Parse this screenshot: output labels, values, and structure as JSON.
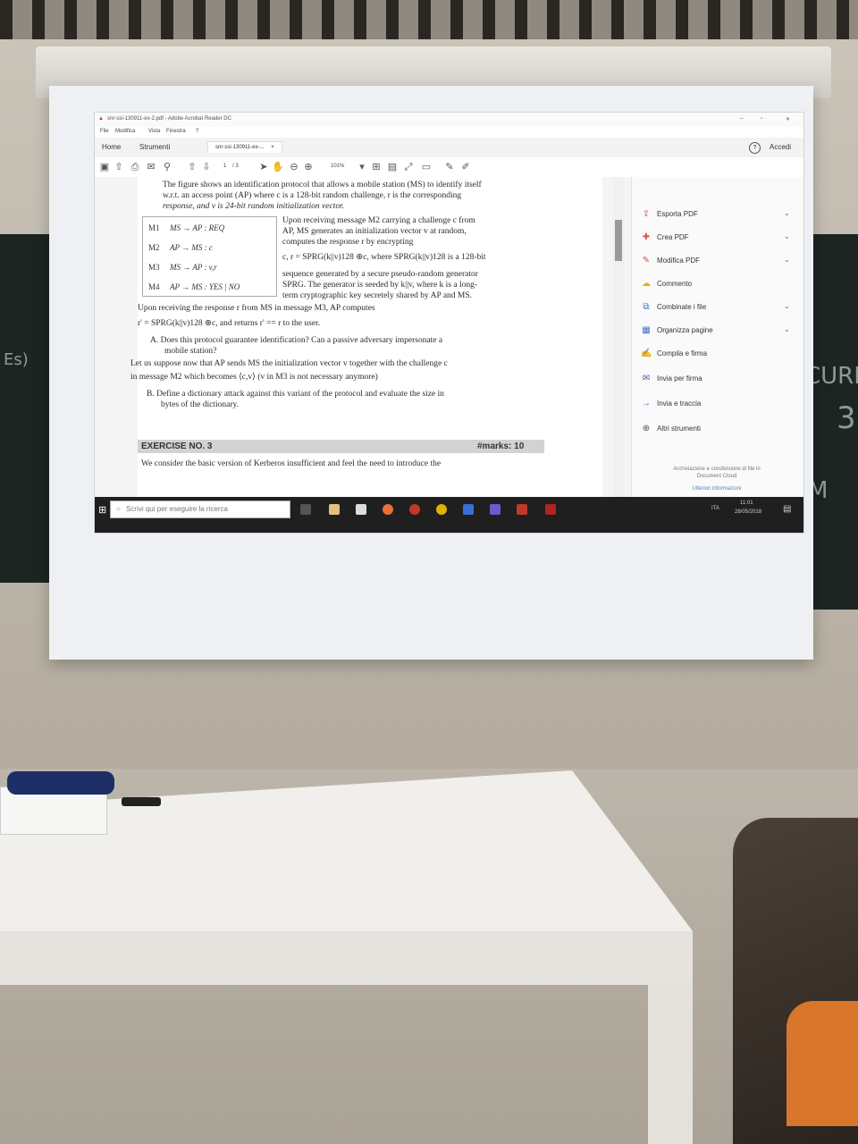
{
  "window": {
    "title": "snr-ssi-130911-ex-2.pdf - Adobe Acrobat Reader DC",
    "controls": [
      "–",
      "▫",
      "✕"
    ]
  },
  "menu": [
    "File",
    "Modifica",
    "Vista",
    "Finestra",
    "?"
  ],
  "tabs": {
    "home": "Home",
    "tools": "Strumenti",
    "document": "snr-ssi-130911-ex-...",
    "document_close": "×",
    "help": "?",
    "signin": "Accedi"
  },
  "toolbar": {
    "page_current": "1",
    "page_total": "/ 3",
    "zoom": "101%"
  },
  "document": {
    "intro_1": "The figure shows an identification protocol that allows a mobile station (MS) to identify itself",
    "intro_2": "w.r.t. an access point (AP) where c is a 128-bit random challenge, r is the corresponding",
    "intro_3": "response, and v is 24-bit random initialization vector.",
    "messages": [
      {
        "id": "M1",
        "flow": "MS → AP :  REQ"
      },
      {
        "id": "M2",
        "flow": "AP → MS :  c"
      },
      {
        "id": "M3",
        "flow": "MS → AP :  v,r"
      },
      {
        "id": "M4",
        "flow": "AP → MS :  YES | NO"
      }
    ],
    "side_1": "Upon receiving message M2 carrying a challenge c from",
    "side_2": "AP, MS generates an initialization vector v at random,",
    "side_3": "computes    the    response    r    by    encrypting",
    "side_4": "c, r = SPRG(k||v)128 ⊕c, where SPRG(k||v)128 is a 128-bit",
    "side_5": "sequence generated by a secure pseudo-random generator",
    "side_6": "SPRG. The generator is seeded by k||v, where k is a long-",
    "side_7": "term cryptographic key secretely shared by AP and MS.",
    "upon_1": "Upon    receiving    the    response    r    from    MS    in    message    M3,    AP    computes",
    "upon_2": "r' = SPRG(k||v)128 ⊕c, and returns r' == r to the user.",
    "q_a_1": "A. Does this protocol guarantee identification? Can a passive adversary impersonate a",
    "q_a_2": "mobile station?",
    "suppose_1": "Let us suppose now that AP sends MS the initialization vector v together with the challenge c",
    "suppose_2": "in message M2 which becomes ⟨c,v⟩ (v in M3 is not necessary anymore)",
    "q_b_1": "B. Define a dictionary attack against this variant of the protocol and evaluate the size in",
    "q_b_2": "bytes of the dictionary.",
    "exercise_title": "EXERCISE NO. 3",
    "exercise_marks": "#marks: 10",
    "exercise_text": "We consider the basic version of Kerberos insufficient and feel the need to introduce the"
  },
  "right_panel": {
    "items": [
      {
        "label": "Esporta PDF",
        "icon": "export-pdf-icon",
        "glyph": "⇪",
        "color": "#d9534f",
        "chevron": true
      },
      {
        "label": "Crea PDF",
        "icon": "create-pdf-icon",
        "glyph": "✚",
        "color": "#d9534f",
        "chevron": true
      },
      {
        "label": "Modifica PDF",
        "icon": "edit-pdf-icon",
        "glyph": "✎",
        "color": "#d9534f",
        "chevron": true
      },
      {
        "label": "Commento",
        "icon": "comment-icon",
        "glyph": "☁",
        "color": "#e0b300",
        "chevron": false
      },
      {
        "label": "Combinate i file",
        "icon": "combine-files-icon",
        "glyph": "⧉",
        "color": "#3a6fd8",
        "chevron": true
      },
      {
        "label": "Organizza pagine",
        "icon": "organize-pages-icon",
        "glyph": "▦",
        "color": "#3a6fd8",
        "chevron": true
      },
      {
        "label": "Compila e firma",
        "icon": "fill-sign-icon",
        "glyph": "✍",
        "color": "#6a3fb5",
        "chevron": false
      },
      {
        "label": "Invia per firma",
        "icon": "send-for-signature-icon",
        "glyph": "✉",
        "color": "#6a3fb5",
        "chevron": false
      },
      {
        "label": "Invia e traccia",
        "icon": "send-track-icon",
        "glyph": "→",
        "color": "#3a6fd8",
        "chevron": false
      },
      {
        "label": "Altri strumenti",
        "icon": "more-tools-icon",
        "glyph": "⊕",
        "color": "#555555",
        "chevron": false
      }
    ],
    "cloud_1": "Archiviazione e condivisione di file in",
    "cloud_2": "Document Cloud",
    "cloud_link": "Ulteriori informazioni"
  },
  "taskbar": {
    "search_placeholder": "Scrivi qui per eseguire la ricerca",
    "lang": "ITA",
    "time": "11:01",
    "date": "28/05/2018"
  },
  "chalk": {
    "left_mark": "Es)",
    "right_mark_1": "CURI",
    "right_mark_2": "3",
    "right_mark_3": "M"
  }
}
